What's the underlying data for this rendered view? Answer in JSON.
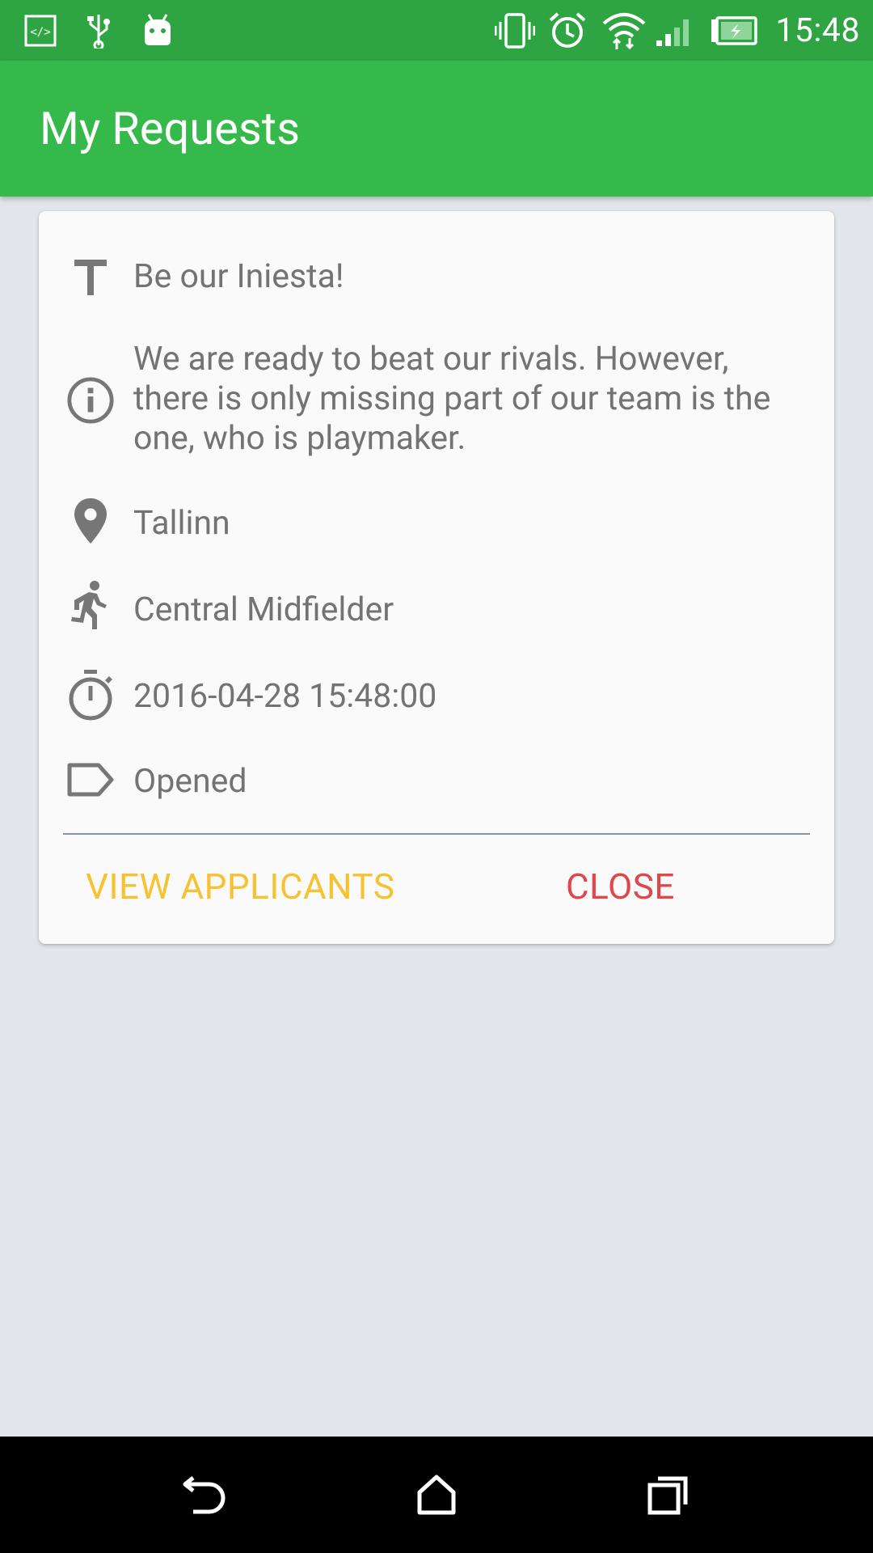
{
  "status_bar": {
    "time": "15:48",
    "left_icons": [
      "developer-code-icon",
      "usb-icon",
      "android-icon"
    ],
    "right_icons": [
      "vibrate-icon",
      "alarm-icon",
      "wifi-icon",
      "cell-signal-icon",
      "battery-charging-icon"
    ]
  },
  "app_bar": {
    "title": "My Requests",
    "color": "#35b94b"
  },
  "request_card": {
    "title": "Be our Iniesta!",
    "description": "We are ready to beat our rivals. However, there is only missing part of our team is the one, who is playmaker.",
    "location": "Tallinn",
    "position": "Central Midfielder",
    "datetime": "2016-04-28 15:48:00",
    "status": "Opened",
    "view_applicants_label": "VIEW APPLICANTS",
    "close_label": "CLOSE",
    "view_color": "#f5c231",
    "close_color": "#e0474a"
  },
  "nav_bar": {
    "icons": [
      "back-icon",
      "home-icon",
      "recents-icon"
    ]
  }
}
